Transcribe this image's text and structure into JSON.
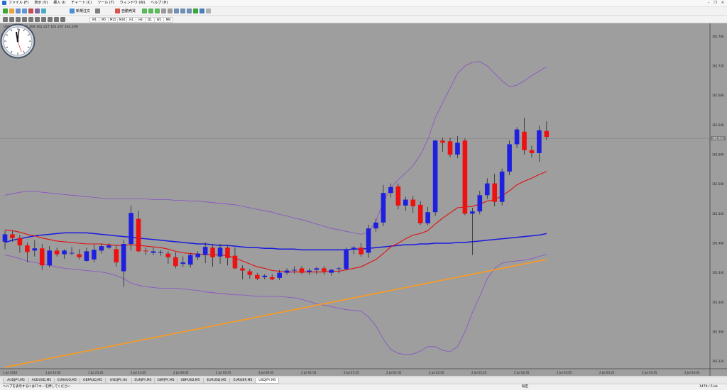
{
  "menu": {
    "items": [
      "ファイル (F)",
      "表示 (V)",
      "挿入 (I)",
      "チャート (C)",
      "ツール (T)",
      "ウィンドウ (W)",
      "ヘルプ (H)"
    ]
  },
  "toolbar": {
    "new_order_label": "新規注文",
    "autotrade_label": "自動売買",
    "timeframes": [
      "M1",
      "M5",
      "M15",
      "M30",
      "H1",
      "H4",
      "D1",
      "W1",
      "MN"
    ]
  },
  "chart": {
    "header": "USDJPY,M5  161.209  161.227  161.207  161.209",
    "price_axis": [
      "161.760",
      "161.720",
      "161.680",
      "161.640",
      "161.600",
      "161.560",
      "161.520",
      "161.480",
      "161.440",
      "161.400",
      "161.360",
      "161.320"
    ],
    "time_axis": [
      "1 Jul 2024",
      "1 Jul 23:05",
      "1 Jul 23:25",
      "1 Jul 23:45",
      "2 Jul 00:05",
      "2 Jul 00:25",
      "2 Jul 00:45",
      "2 Jul 01:05",
      "2 Jul 01:25",
      "2 Jul 01:45",
      "2 Jul 02:05",
      "2 Jul 02:25",
      "2 Jul 02:45",
      "2 Jul 03:05",
      "2 Jul 03:25",
      "2 Jul 03:45",
      "2 Jul 04:05"
    ],
    "current_price": "161.622",
    "colors": {
      "background": "#9e9e9e",
      "bull": "#1f1fe0",
      "bear": "#ee1111",
      "ma_fast": "#e01010",
      "ma_mid": "#1a1ae0",
      "ma_slow": "#ff9a1a",
      "bands": "#8a4fc8"
    }
  },
  "chart_data": {
    "type": "candlestick",
    "symbol": "USDJPY",
    "timeframe": "M5",
    "ylim": [
      161.31,
      161.77
    ],
    "candles": [
      {
        "o": 161.482,
        "h": 161.497,
        "l": 161.472,
        "c": 161.492
      },
      {
        "o": 161.492,
        "h": 161.497,
        "l": 161.482,
        "c": 161.487
      },
      {
        "o": 161.487,
        "h": 161.491,
        "l": 161.467,
        "c": 161.477
      },
      {
        "o": 161.477,
        "h": 161.481,
        "l": 161.454,
        "c": 161.468
      },
      {
        "o": 161.47,
        "h": 161.484,
        "l": 161.462,
        "c": 161.473
      },
      {
        "o": 161.473,
        "h": 161.479,
        "l": 161.444,
        "c": 161.45
      },
      {
        "o": 161.45,
        "h": 161.476,
        "l": 161.447,
        "c": 161.47
      },
      {
        "o": 161.47,
        "h": 161.474,
        "l": 161.462,
        "c": 161.465
      },
      {
        "o": 161.465,
        "h": 161.472,
        "l": 161.459,
        "c": 161.47
      },
      {
        "o": 161.467,
        "h": 161.475,
        "l": 161.464,
        "c": 161.467
      },
      {
        "o": 161.465,
        "h": 161.472,
        "l": 161.458,
        "c": 161.461
      },
      {
        "o": 161.456,
        "h": 161.474,
        "l": 161.455,
        "c": 161.469
      },
      {
        "o": 161.458,
        "h": 161.478,
        "l": 161.454,
        "c": 161.471
      },
      {
        "o": 161.47,
        "h": 161.479,
        "l": 161.466,
        "c": 161.476
      },
      {
        "o": 161.474,
        "h": 161.48,
        "l": 161.472,
        "c": 161.477
      },
      {
        "o": 161.472,
        "h": 161.477,
        "l": 161.448,
        "c": 161.454
      },
      {
        "o": 161.442,
        "h": 161.485,
        "l": 161.421,
        "c": 161.479
      },
      {
        "o": 161.479,
        "h": 161.531,
        "l": 161.47,
        "c": 161.521
      },
      {
        "o": 161.513,
        "h": 161.524,
        "l": 161.468,
        "c": 161.469
      },
      {
        "o": 161.47,
        "h": 161.474,
        "l": 161.464,
        "c": 161.469
      },
      {
        "o": 161.467,
        "h": 161.474,
        "l": 161.464,
        "c": 161.469
      },
      {
        "o": 161.467,
        "h": 161.471,
        "l": 161.463,
        "c": 161.468
      },
      {
        "o": 161.466,
        "h": 161.469,
        "l": 161.452,
        "c": 161.461
      },
      {
        "o": 161.461,
        "h": 161.468,
        "l": 161.446,
        "c": 161.449
      },
      {
        "o": 161.452,
        "h": 161.462,
        "l": 161.448,
        "c": 161.454
      },
      {
        "o": 161.451,
        "h": 161.467,
        "l": 161.447,
        "c": 161.464
      },
      {
        "o": 161.461,
        "h": 161.469,
        "l": 161.457,
        "c": 161.466
      },
      {
        "o": 161.464,
        "h": 161.481,
        "l": 161.453,
        "c": 161.475
      },
      {
        "o": 161.474,
        "h": 161.478,
        "l": 161.448,
        "c": 161.461
      },
      {
        "o": 161.462,
        "h": 161.479,
        "l": 161.452,
        "c": 161.474
      },
      {
        "o": 161.474,
        "h": 161.477,
        "l": 161.45,
        "c": 161.46
      },
      {
        "o": 161.463,
        "h": 161.474,
        "l": 161.445,
        "c": 161.446
      },
      {
        "o": 161.446,
        "h": 161.45,
        "l": 161.431,
        "c": 161.443
      },
      {
        "o": 161.442,
        "h": 161.445,
        "l": 161.432,
        "c": 161.437
      },
      {
        "o": 161.437,
        "h": 161.44,
        "l": 161.43,
        "c": 161.432
      },
      {
        "o": 161.434,
        "h": 161.438,
        "l": 161.431,
        "c": 161.436
      },
      {
        "o": 161.434,
        "h": 161.438,
        "l": 161.43,
        "c": 161.431
      },
      {
        "o": 161.433,
        "h": 161.444,
        "l": 161.43,
        "c": 161.44
      },
      {
        "o": 161.44,
        "h": 161.446,
        "l": 161.437,
        "c": 161.443
      },
      {
        "o": 161.443,
        "h": 161.449,
        "l": 161.439,
        "c": 161.444
      },
      {
        "o": 161.446,
        "h": 161.449,
        "l": 161.438,
        "c": 161.44
      },
      {
        "o": 161.441,
        "h": 161.446,
        "l": 161.437,
        "c": 161.443
      },
      {
        "o": 161.444,
        "h": 161.448,
        "l": 161.438,
        "c": 161.446
      },
      {
        "o": 161.446,
        "h": 161.449,
        "l": 161.437,
        "c": 161.442
      },
      {
        "o": 161.44,
        "h": 161.445,
        "l": 161.436,
        "c": 161.444
      },
      {
        "o": 161.446,
        "h": 161.448,
        "l": 161.439,
        "c": 161.446
      },
      {
        "o": 161.445,
        "h": 161.474,
        "l": 161.443,
        "c": 161.472
      },
      {
        "o": 161.472,
        "h": 161.476,
        "l": 161.465,
        "c": 161.474
      },
      {
        "o": 161.474,
        "h": 161.48,
        "l": 161.462,
        "c": 161.465
      },
      {
        "o": 161.467,
        "h": 161.505,
        "l": 161.46,
        "c": 161.5
      },
      {
        "o": 161.5,
        "h": 161.513,
        "l": 161.495,
        "c": 161.508
      },
      {
        "o": 161.508,
        "h": 161.559,
        "l": 161.503,
        "c": 161.548
      },
      {
        "o": 161.548,
        "h": 161.561,
        "l": 161.542,
        "c": 161.556
      },
      {
        "o": 161.557,
        "h": 161.561,
        "l": 161.526,
        "c": 161.531
      },
      {
        "o": 161.531,
        "h": 161.543,
        "l": 161.524,
        "c": 161.539
      },
      {
        "o": 161.539,
        "h": 161.544,
        "l": 161.521,
        "c": 161.53
      },
      {
        "o": 161.532,
        "h": 161.537,
        "l": 161.505,
        "c": 161.507
      },
      {
        "o": 161.507,
        "h": 161.529,
        "l": 161.504,
        "c": 161.522
      },
      {
        "o": 161.522,
        "h": 161.62,
        "l": 161.517,
        "c": 161.619
      },
      {
        "o": 161.619,
        "h": 161.623,
        "l": 161.604,
        "c": 161.616
      },
      {
        "o": 161.618,
        "h": 161.623,
        "l": 161.596,
        "c": 161.6
      },
      {
        "o": 161.6,
        "h": 161.625,
        "l": 161.595,
        "c": 161.616
      },
      {
        "o": 161.619,
        "h": 161.622,
        "l": 161.518,
        "c": 161.52
      },
      {
        "o": 161.52,
        "h": 161.528,
        "l": 161.464,
        "c": 161.523
      },
      {
        "o": 161.523,
        "h": 161.551,
        "l": 161.519,
        "c": 161.545
      },
      {
        "o": 161.545,
        "h": 161.568,
        "l": 161.54,
        "c": 161.561
      },
      {
        "o": 161.561,
        "h": 161.574,
        "l": 161.53,
        "c": 161.536
      },
      {
        "o": 161.536,
        "h": 161.581,
        "l": 161.531,
        "c": 161.577
      },
      {
        "o": 161.577,
        "h": 161.619,
        "l": 161.572,
        "c": 161.614
      },
      {
        "o": 161.614,
        "h": 161.637,
        "l": 161.609,
        "c": 161.634
      },
      {
        "o": 161.631,
        "h": 161.65,
        "l": 161.6,
        "c": 161.606
      },
      {
        "o": 161.606,
        "h": 161.612,
        "l": 161.596,
        "c": 161.602
      },
      {
        "o": 161.602,
        "h": 161.639,
        "l": 161.59,
        "c": 161.633
      },
      {
        "o": 161.632,
        "h": 161.645,
        "l": 161.62,
        "c": 161.624
      }
    ],
    "ma_fast": [
      161.498,
      161.497,
      161.495,
      161.492,
      161.49,
      161.487,
      161.485,
      161.483,
      161.482,
      161.481,
      161.48,
      161.479,
      161.479,
      161.479,
      161.478,
      161.477,
      161.477,
      161.478,
      161.477,
      161.476,
      161.475,
      161.474,
      161.472,
      161.469,
      161.467,
      161.466,
      161.465,
      161.465,
      161.464,
      161.464,
      161.463,
      161.46,
      161.456,
      161.452,
      161.448,
      161.446,
      161.443,
      161.442,
      161.441,
      161.441,
      161.441,
      161.441,
      161.441,
      161.441,
      161.442,
      161.442,
      161.444,
      161.446,
      161.448,
      161.453,
      161.458,
      161.466,
      161.475,
      161.48,
      161.486,
      161.491,
      161.493,
      161.497,
      161.506,
      161.514,
      161.521,
      161.528,
      161.529,
      161.53,
      161.533,
      161.537,
      161.539,
      161.544,
      161.551,
      161.559,
      161.564,
      161.568,
      161.573,
      161.577
    ],
    "ma_mid": [
      161.481,
      161.484,
      161.486,
      161.488,
      161.49,
      161.491,
      161.492,
      161.493,
      161.494,
      161.494,
      161.494,
      161.494,
      161.493,
      161.492,
      161.491,
      161.49,
      161.489,
      161.488,
      161.487,
      161.486,
      161.485,
      161.484,
      161.483,
      161.482,
      161.481,
      161.48,
      161.479,
      161.479,
      161.478,
      161.477,
      161.477,
      161.476,
      161.475,
      161.474,
      161.474,
      161.473,
      161.473,
      161.472,
      161.472,
      161.472,
      161.471,
      161.471,
      161.471,
      161.471,
      161.471,
      161.471,
      161.471,
      161.472,
      161.472,
      161.473,
      161.474,
      161.475,
      161.476,
      161.477,
      161.478,
      161.478,
      161.479,
      161.479,
      161.48,
      161.48,
      161.48,
      161.481,
      161.481,
      161.482,
      161.483,
      161.484,
      161.485,
      161.486,
      161.487,
      161.488,
      161.489,
      161.49,
      161.491,
      161.493
    ],
    "ma_slow": [
      161.312,
      161.314,
      161.316,
      161.318,
      161.32,
      161.322,
      161.324,
      161.326,
      161.328,
      161.33,
      161.332,
      161.334,
      161.336,
      161.338,
      161.34,
      161.342,
      161.344,
      161.346,
      161.348,
      161.35,
      161.352,
      161.354,
      161.356,
      161.358,
      161.36,
      161.362,
      161.364,
      161.366,
      161.368,
      161.37,
      161.372,
      161.374,
      161.376,
      161.378,
      161.38,
      161.382,
      161.384,
      161.386,
      161.388,
      161.39,
      161.392,
      161.394,
      161.396,
      161.398,
      161.4,
      161.402,
      161.404,
      161.406,
      161.408,
      161.41,
      161.412,
      161.414,
      161.416,
      161.418,
      161.42,
      161.422,
      161.424,
      161.426,
      161.428,
      161.43,
      161.432,
      161.434,
      161.436,
      161.438,
      161.44,
      161.442,
      161.444,
      161.446,
      161.448,
      161.45,
      161.452,
      161.454,
      161.456,
      161.458
    ],
    "band_upper": [
      161.545,
      161.547,
      161.549,
      161.55,
      161.55,
      161.549,
      161.548,
      161.547,
      161.546,
      161.545,
      161.544,
      161.543,
      161.542,
      161.541,
      161.54,
      161.54,
      161.54,
      161.54,
      161.54,
      161.54,
      161.539,
      161.539,
      161.539,
      161.538,
      161.538,
      161.537,
      161.537,
      161.536,
      161.535,
      161.534,
      161.533,
      161.532,
      161.53,
      161.528,
      161.526,
      161.524,
      161.522,
      161.519,
      161.517,
      161.514,
      161.512,
      161.509,
      161.506,
      161.503,
      161.5,
      161.498,
      161.496,
      161.494,
      161.492,
      161.495,
      161.51,
      161.535,
      161.555,
      161.566,
      161.575,
      161.585,
      161.6,
      161.62,
      161.65,
      161.67,
      161.69,
      161.71,
      161.72,
      161.725,
      161.726,
      161.72,
      161.71,
      161.7,
      161.692,
      161.694,
      161.7,
      161.707,
      161.713,
      161.719
    ],
    "band_lower": [
      161.464,
      161.462,
      161.459,
      161.456,
      161.454,
      161.452,
      161.45,
      161.448,
      161.446,
      161.445,
      161.444,
      161.443,
      161.442,
      161.441,
      161.439,
      161.436,
      161.432,
      161.426,
      161.423,
      161.421,
      161.42,
      161.419,
      161.419,
      161.419,
      161.418,
      161.417,
      161.416,
      161.414,
      161.413,
      161.412,
      161.411,
      161.41,
      161.41,
      161.409,
      161.408,
      161.408,
      161.408,
      161.408,
      161.407,
      161.406,
      161.404,
      161.401,
      161.398,
      161.396,
      161.394,
      161.392,
      161.39,
      161.389,
      161.388,
      161.38,
      161.368,
      161.35,
      161.336,
      161.331,
      161.329,
      161.33,
      161.334,
      161.34,
      161.34,
      161.335,
      161.333,
      161.34,
      161.36,
      161.386,
      161.408,
      161.432,
      161.446,
      161.453,
      161.455,
      161.456,
      161.457,
      161.459,
      161.462,
      161.465
    ]
  },
  "tabs": {
    "items": [
      "AUDJPY,M5",
      "AUDUSD,M5",
      "EURAUD,M5",
      "GBPAUD,M5",
      "USDJPY,H4",
      "EURJPY,M5",
      "GBPJPY,M5",
      "GBPUSD,M5",
      "EURUSD,M5",
      "EURGBP,M5",
      "USDJPY,M5"
    ],
    "active_index": 10
  },
  "status": {
    "help_text": "ヘルプを表示するにはF1キーを押してください",
    "profile": "既定",
    "connection": "1479 / 5 kb"
  }
}
